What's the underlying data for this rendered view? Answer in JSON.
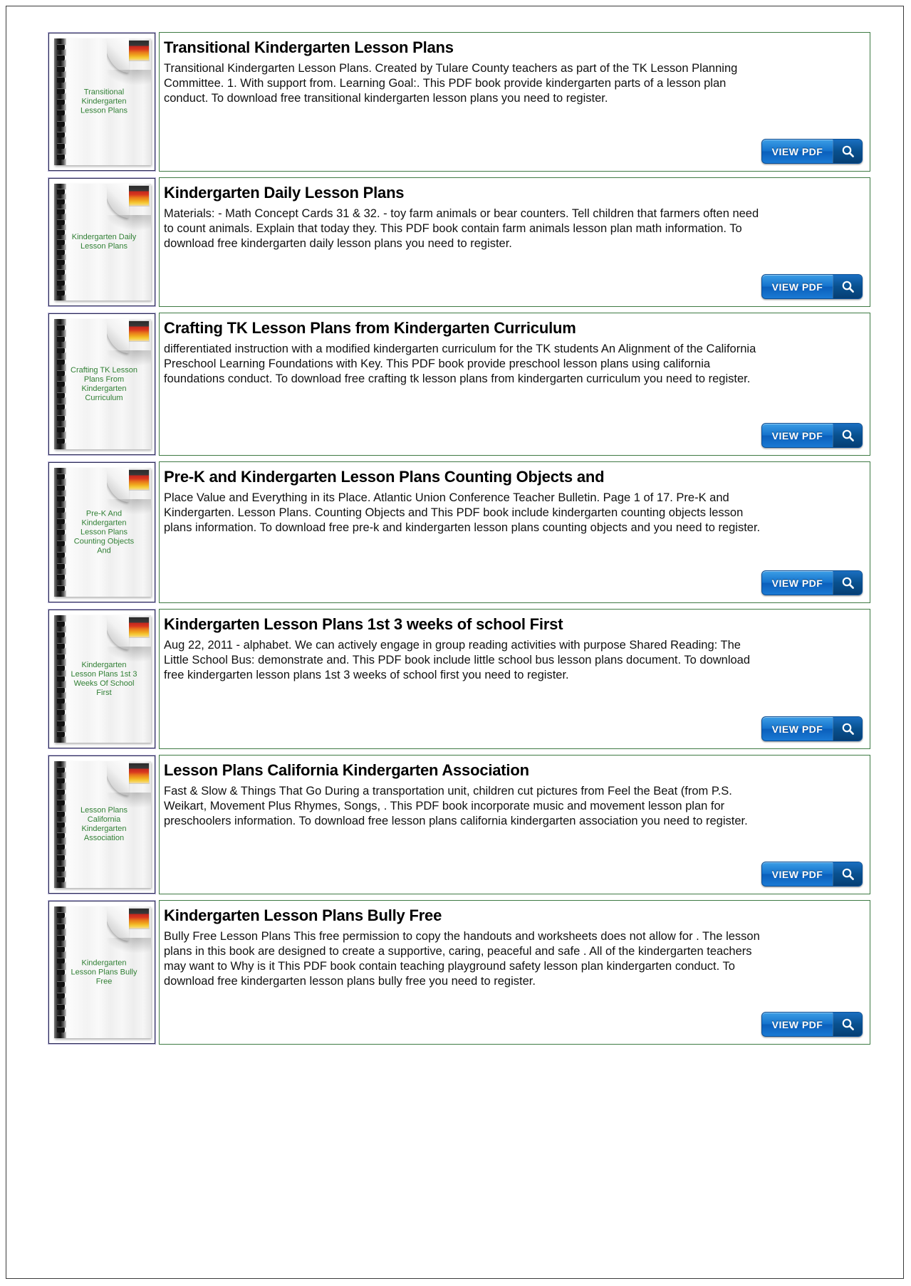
{
  "page": {
    "title": "Kindergarten Lesson Plans PDF search results"
  },
  "button": {
    "label": "VIEW PDF",
    "search_icon": "magnifying-glass-icon"
  },
  "colors": {
    "panel_border": "#3e7a43",
    "thumb_border": "#2a2a55",
    "thumb_outer_border": "#b9b4d8",
    "caption_text": "#2e7d32",
    "button_blue": "#1573cd",
    "button_dark_blue": "#08508f",
    "page_border": "#3a3a3a"
  },
  "results": [
    {
      "thumb_caption": "Transitional\nKindergarten\nLesson Plans",
      "title": "Transitional Kindergarten Lesson Plans",
      "body": "Transitional Kindergarten Lesson Plans. Created by Tulare County teachers as part of the TK Lesson Planning Committee. 1. With support from. Learning Goal:. This PDF book provide kindergarten parts of a lesson plan conduct. To download free transitional kindergarten lesson plans you need to register."
    },
    {
      "thumb_caption": "Kindergarten Daily\nLesson Plans",
      "title": "Kindergarten Daily Lesson Plans",
      "body": "Materials: - Math Concept Cards 31 & 32. - toy farm animals or bear counters. Tell children that farmers often need to count animals. Explain that today they. This PDF book contain farm animals lesson plan math information. To download free kindergarten daily lesson plans you need to register."
    },
    {
      "thumb_caption": "Crafting TK Lesson\nPlans From\nKindergarten\nCurriculum",
      "title": "Crafting TK Lesson Plans from Kindergarten Curriculum",
      "body": "differentiated instruction with a modified kindergarten curriculum for the TK students An Alignment of the California Preschool Learning Foundations with Key. This PDF book provide preschool lesson plans using california foundations conduct. To download free crafting tk lesson plans from kindergarten curriculum you need to register."
    },
    {
      "thumb_caption": "Pre-K And\nKindergarten\nLesson Plans\nCounting Objects\nAnd",
      "title": "Pre-K and Kindergarten Lesson Plans Counting Objects and",
      "body": "Place Value and Everything in its Place. Atlantic Union Conference Teacher Bulletin. Page 1 of 17. Pre-K and Kindergarten. Lesson Plans. Counting Objects and  This PDF book include kindergarten counting objects lesson plans information. To download free pre-k and kindergarten lesson plans counting objects and you need to register."
    },
    {
      "thumb_caption": "Kindergarten\nLesson Plans 1st 3\nWeeks Of School\nFirst",
      "title": "Kindergarten Lesson Plans 1st 3 weeks of school First",
      "body": "Aug 22, 2011 - alphabet. We can actively engage in group reading activities with purpose Shared Reading: The Little School Bus: demonstrate and. This PDF book include little school bus lesson plans document. To download free kindergarten lesson plans 1st 3 weeks of school first you need to register."
    },
    {
      "thumb_caption": "Lesson Plans\nCalifornia\nKindergarten\nAssociation",
      "title": "Lesson Plans California Kindergarten Association",
      "body": "Fast & Slow & Things That Go During a transportation unit, children cut pictures from Feel the Beat (from P.S. Weikart, Movement Plus Rhymes, Songs, . This PDF book incorporate music and movement lesson plan for preschoolers information. To download free lesson plans california kindergarten association you need to register."
    },
    {
      "thumb_caption": "Kindergarten\nLesson Plans Bully\nFree",
      "title": "Kindergarten Lesson Plans Bully Free",
      "body": "Bully Free Lesson Plans This free permission to copy the handouts and worksheets does not allow for . The lesson plans in this book are designed to create a supportive, caring, peaceful and safe . All of the kindergarten teachers may want to Why is it This PDF book contain teaching playground safety lesson plan kindergarten conduct. To download free kindergarten lesson plans bully free you need to register."
    }
  ]
}
